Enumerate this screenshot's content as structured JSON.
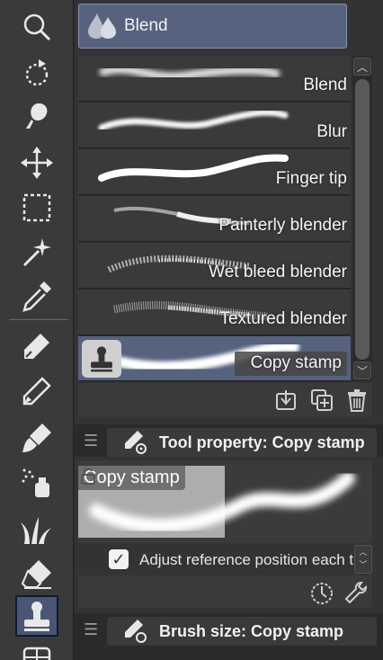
{
  "toolbar": {
    "tools": [
      {
        "name": "zoom-tool",
        "icon": "magnifier-icon"
      },
      {
        "name": "rotate-tool",
        "icon": "rotate-icon"
      },
      {
        "name": "operation-tool",
        "icon": "lasso-pointer-icon"
      },
      {
        "name": "move-tool",
        "icon": "move-arrows-icon"
      },
      {
        "name": "selection-tool",
        "icon": "dashed-rectangle-icon"
      },
      {
        "name": "auto-select-tool",
        "icon": "magic-wand-icon"
      },
      {
        "name": "eyedropper-tool",
        "icon": "eyedropper-icon"
      },
      {
        "name": "pen-tool",
        "icon": "pen-nib-icon"
      },
      {
        "name": "pencil-tool",
        "icon": "pencil-icon"
      },
      {
        "name": "brush-tool",
        "icon": "brush-icon"
      },
      {
        "name": "airbrush-tool",
        "icon": "airbrush-icon"
      },
      {
        "name": "decoration-tool",
        "icon": "grass-icon"
      },
      {
        "name": "eraser-tool",
        "icon": "eraser-icon"
      },
      {
        "name": "blend-tool",
        "icon": "stamp-icon",
        "active": true
      },
      {
        "name": "fill-tool",
        "icon": "grid-icon"
      }
    ]
  },
  "sub_tool": {
    "group_label": "Blend",
    "group_icon": "blend-drops-icon",
    "brushes": [
      {
        "label": "Blend"
      },
      {
        "label": "Blur"
      },
      {
        "label": "Finger tip"
      },
      {
        "label": "Painterly blender"
      },
      {
        "label": "Wet bleed blender"
      },
      {
        "label": "Textured blender"
      },
      {
        "label": "Copy stamp",
        "selected": true
      }
    ],
    "actions": [
      "import-icon",
      "duplicate-icon",
      "trash-icon"
    ]
  },
  "tool_property": {
    "title": "Tool property: Copy stamp",
    "preview_label": "Copy stamp",
    "checkbox_label": "Adjust reference position each time",
    "checkbox_checked": true
  },
  "brush_size": {
    "title": "Brush size: Copy stamp"
  },
  "colors": {
    "selected": "#56627e",
    "panel": "#333333",
    "toolbar": "#3a3a3a"
  }
}
